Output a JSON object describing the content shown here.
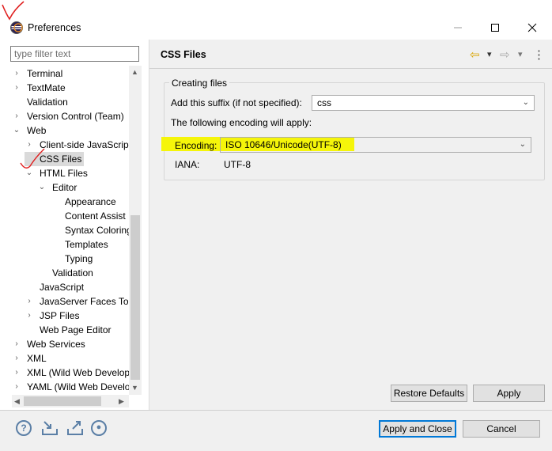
{
  "window": {
    "title": "Preferences",
    "minimize": "—",
    "maximize": "□",
    "close": "✕"
  },
  "filter": {
    "placeholder": "type filter text"
  },
  "tree": [
    {
      "label": "Terminal",
      "indent": 0,
      "twisty": "›"
    },
    {
      "label": "TextMate",
      "indent": 0,
      "twisty": "›"
    },
    {
      "label": "Validation",
      "indent": 0,
      "twisty": ""
    },
    {
      "label": "Version Control (Team)",
      "indent": 0,
      "twisty": "›"
    },
    {
      "label": "Web",
      "indent": 0,
      "twisty": "⌄"
    },
    {
      "label": "Client-side JavaScript",
      "indent": 1,
      "twisty": "›"
    },
    {
      "label": "CSS Files",
      "indent": 1,
      "twisty": "",
      "selected": true
    },
    {
      "label": "HTML Files",
      "indent": 1,
      "twisty": "⌄"
    },
    {
      "label": "Editor",
      "indent": 2,
      "twisty": "⌄"
    },
    {
      "label": "Appearance",
      "indent": 3,
      "twisty": ""
    },
    {
      "label": "Content Assist",
      "indent": 3,
      "twisty": ""
    },
    {
      "label": "Syntax Coloring",
      "indent": 3,
      "twisty": ""
    },
    {
      "label": "Templates",
      "indent": 3,
      "twisty": ""
    },
    {
      "label": "Typing",
      "indent": 3,
      "twisty": ""
    },
    {
      "label": "Validation",
      "indent": 2,
      "twisty": ""
    },
    {
      "label": "JavaScript",
      "indent": 1,
      "twisty": ""
    },
    {
      "label": "JavaServer Faces Tools",
      "indent": 1,
      "twisty": "›"
    },
    {
      "label": "JSP Files",
      "indent": 1,
      "twisty": "›"
    },
    {
      "label": "Web Page Editor",
      "indent": 1,
      "twisty": ""
    },
    {
      "label": "Web Services",
      "indent": 0,
      "twisty": "›"
    },
    {
      "label": "XML",
      "indent": 0,
      "twisty": "›"
    },
    {
      "label": "XML (Wild Web Developer)",
      "indent": 0,
      "twisty": "›"
    },
    {
      "label": "YAML (Wild Web Developer)",
      "indent": 0,
      "twisty": "›"
    }
  ],
  "page": {
    "title": "CSS Files",
    "group_label": "Creating files",
    "suffix_label": "Add this suffix (if not specified):",
    "suffix_value": "css",
    "encoding_info": "The following encoding will apply:",
    "encoding_label": "Encoding:",
    "encoding_value": "ISO 10646/Unicode(UTF-8)",
    "iana_label": "IANA:",
    "iana_value": "UTF-8",
    "nav_back": "⇦",
    "nav_forward": "⇨",
    "menu_icon": "⋮",
    "dropdown": "▾"
  },
  "buttons": {
    "restore_defaults": "Restore Defaults",
    "apply": "Apply",
    "apply_and_close": "Apply and Close",
    "cancel": "Cancel"
  },
  "bottom_icons": {
    "help": "?",
    "record": "●"
  },
  "colors": {
    "highlight": "#f5f50a",
    "accent": "#0078d7",
    "annotation": "#e02020"
  }
}
